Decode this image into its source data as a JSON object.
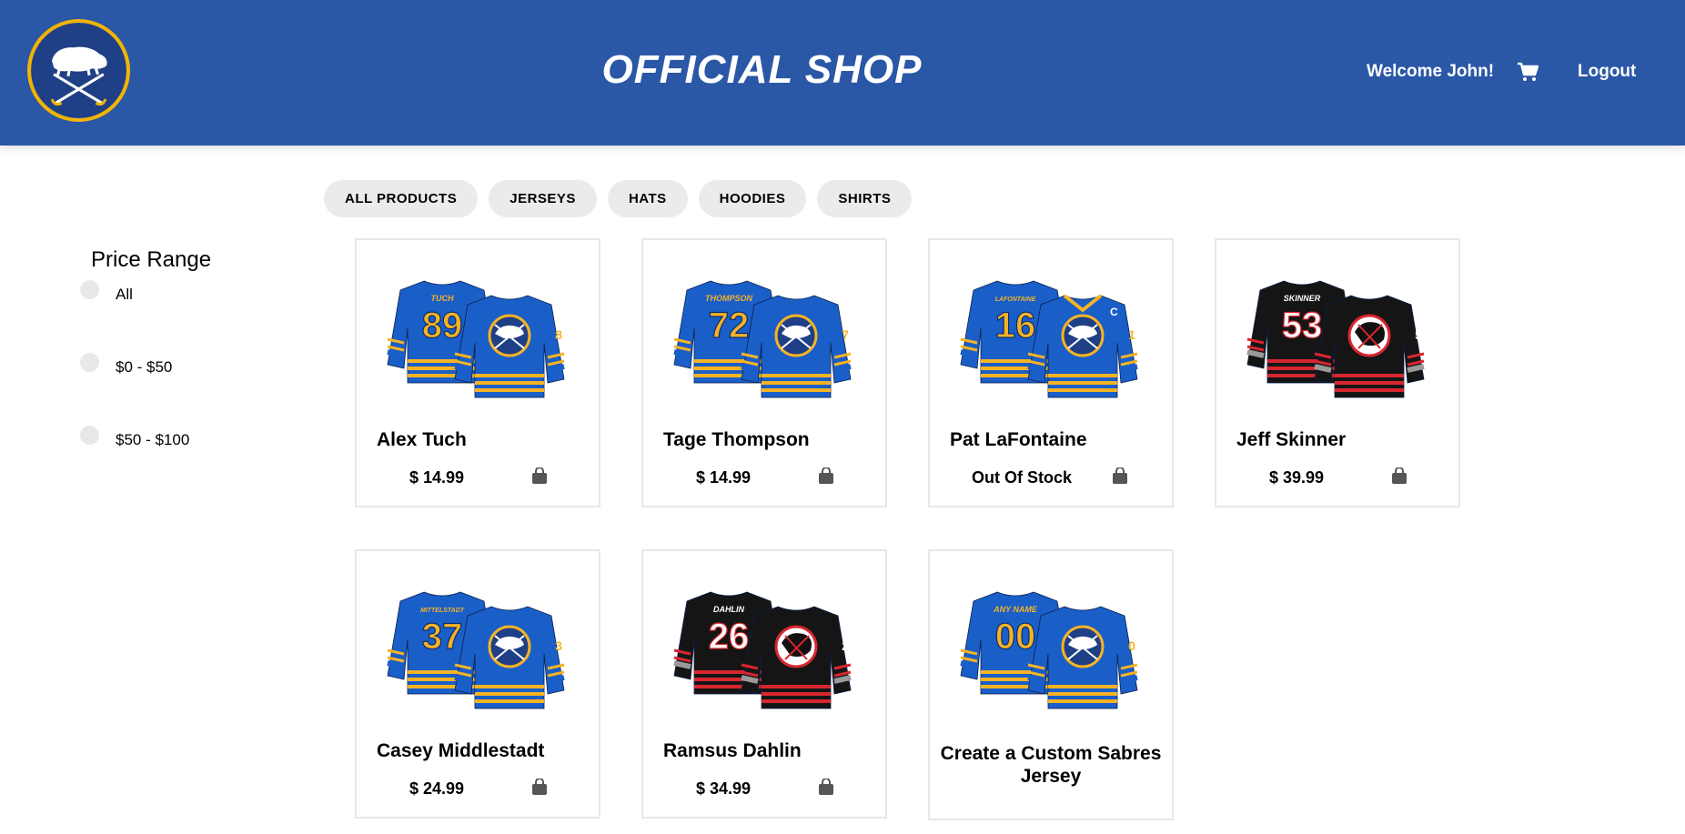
{
  "header": {
    "title": "OFFICIAL SHOP",
    "welcome": "Welcome John!",
    "logout_label": "Logout",
    "logo_icon": "sabres-buffalo-logo",
    "cart_icon": "shopping-cart-icon"
  },
  "tabs": [
    "ALL PRODUCTS",
    "JERSEYS",
    "HATS",
    "HOODIES",
    "SHIRTS"
  ],
  "sidebar": {
    "title": "Price Range",
    "options": [
      "All",
      "$0 - $50",
      "$50 - $100"
    ]
  },
  "products": [
    {
      "name": "Alex Tuch",
      "price": "$ 14.99",
      "jersey_name": "TUCH",
      "number": "89",
      "style": "blue"
    },
    {
      "name": "Tage Thompson",
      "price": "$ 14.99",
      "jersey_name": "THOMPSON",
      "number": "72",
      "style": "blue"
    },
    {
      "name": "Pat LaFontaine",
      "price": "Out Of Stock",
      "jersey_name": "LAFONTAINE",
      "number": "16",
      "style": "retro"
    },
    {
      "name": "Jeff Skinner",
      "price": "$ 39.99",
      "jersey_name": "SKINNER",
      "number": "53",
      "style": "black"
    },
    {
      "name": "Casey Middlestadt",
      "price": "$ 24.99",
      "jersey_name": "MITTELSTADT",
      "number": "37",
      "style": "blue"
    },
    {
      "name": "Ramsus Dahlin",
      "price": "$ 34.99",
      "jersey_name": "DAHLIN",
      "number": "26",
      "style": "black"
    },
    {
      "name": "Create a Custom Sabres Jersey",
      "price": "",
      "jersey_name": "ANY NAME",
      "number": "00",
      "style": "blue"
    }
  ],
  "colors": {
    "header_blue": "#2a57a6",
    "sabres_blue": "#1a5ec8",
    "sabres_gold": "#f5b324",
    "tab_bg": "#ebebeb",
    "black_jersey": "#151515",
    "red_accent": "#d7262f"
  }
}
